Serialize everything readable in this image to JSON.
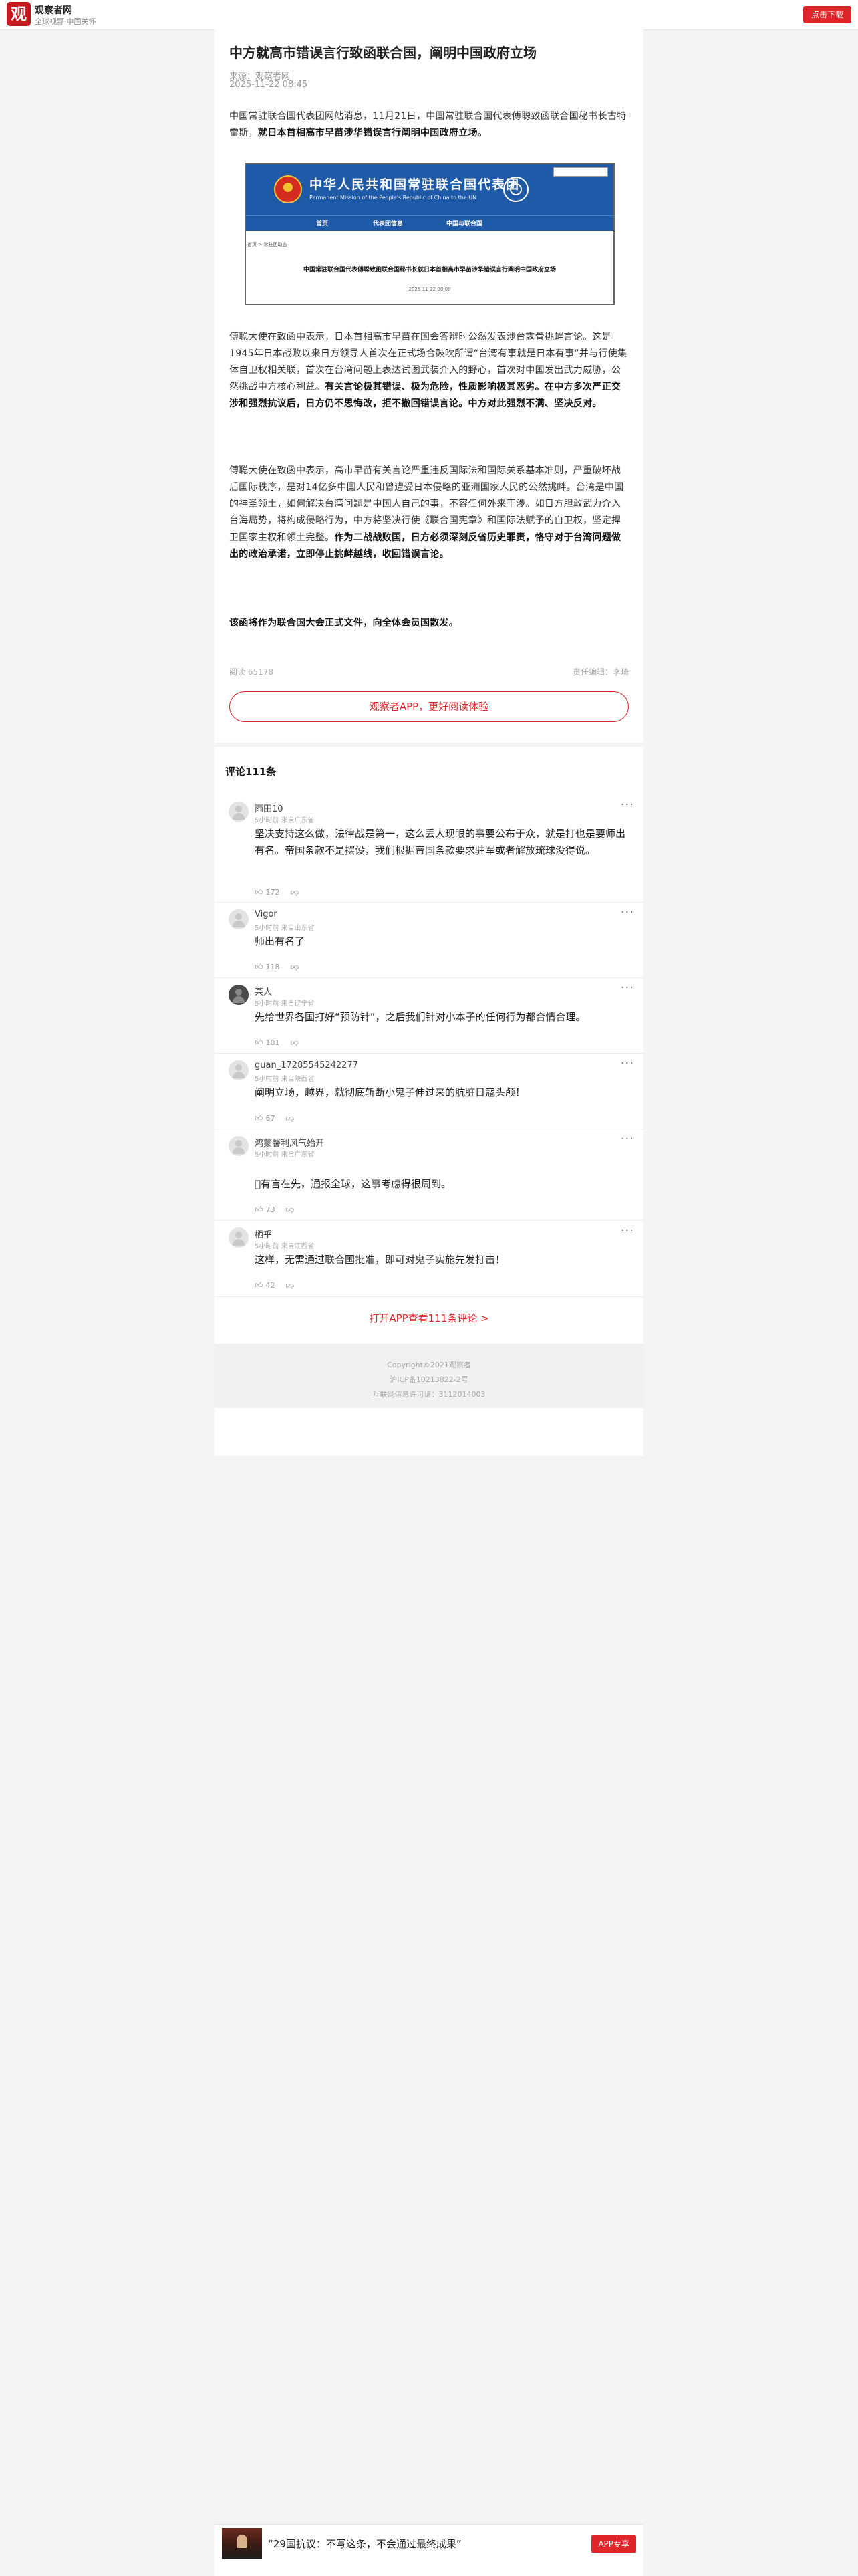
{
  "header": {
    "logo_glyph": "观",
    "site_name": "观察者网",
    "slogan": "全球视野·中国关怀",
    "download_label": "点击下载"
  },
  "article": {
    "title": "中方就高市错误言行致函联合国，阐明中国政府立场",
    "source": "来源：观察者网",
    "date": "2025-11-22 08:45",
    "p1_normal": "中国常驻联合国代表团网站消息，11月21日，中国常驻联合国代表傅聪致函联合国秘书长古特雷斯，",
    "p1_bold": "就日本首相高市早苗涉华错误言行阐明中国政府立场。",
    "p2_normal": "傅聪大使在致函中表示，日本首相高市早苗在国会答辩时公然发表涉台露骨挑衅言论。这是1945年日本战败以来日方领导人首次在正式场合鼓吹所谓“台湾有事就是日本有事”并与行使集体自卫权相关联，首次在台湾问题上表达试图武装介入的野心，首次对中国发出武力威胁，公然挑战中方核心利益。",
    "p2_bold": "有关言论极其错误、极为危险，性质影响极其恶劣。在中方多次严正交涉和强烈抗议后，日方仍不思悔改，拒不撤回错误言论。中方对此强烈不满、坚决反对。",
    "p3_normal": "傅聪大使在致函中表示，高市早苗有关言论严重违反国际法和国际关系基本准则，严重破坏战后国际秩序，是对14亿多中国人民和曾遭受日本侵略的亚洲国家人民的公然挑衅。台湾是中国的神圣领土，如何解决台湾问题是中国人自己的事，不容任何外来干涉。如日方胆敢武力介入台海局势，将构成侵略行为，中方将坚决行使《联合国宪章》和国际法赋予的自卫权，坚定捍卫国家主权和领土完整。",
    "p3_bold": "作为二战战败国，日方必须深刻反省历史罪责，恪守对于台湾问题做出的政治承诺，立即停止挑衅越线，收回错误言论。",
    "p4_bold": "该函将作为联合国大会正式文件，向全体会员国散发。",
    "read_count": "阅读 65178",
    "editor": "责任编辑：李琦",
    "app_button_label": "观察者APP，更好阅读体验"
  },
  "embedded_image": {
    "org_cn": "中华人民共和国常驻联合国代表团",
    "org_en": "Permanent Mission of the People's Republic of China to the UN",
    "nav": [
      "首页",
      "代表团信息",
      "中国与联合国"
    ],
    "breadcrumb": "首页 > 常驻团动态",
    "headline": "中国常驻联合国代表傅聪致函联合国秘书长就日本首相高市早苗涉华错误言行阐明中国政府立场",
    "date": "2025-11-22 00:00"
  },
  "comments": {
    "header": "评论111条",
    "items": [
      {
        "name": "雨田10",
        "meta": "5小时前  来自广东省",
        "text": "坚决支持这么做，法律战是第一，这么丢人现眼的事要公布于众，就是打也是要师出有名。帝国条款不是摆设，我们根据帝国条款要求驻军或者解放琉球没得说。",
        "likes": "172"
      },
      {
        "name": "Vigor",
        "meta": "5小时前  来自山东省",
        "text": "师出有名了",
        "likes": "118"
      },
      {
        "name": "某人",
        "meta": "5小时前  来自辽宁省",
        "text": "先给世界各国打好“预防针”，之后我们针对小本子的任何行为都合情合理。",
        "likes": "101"
      },
      {
        "name": "guan_17285545242277",
        "meta": "5小时前  来自陕西省",
        "text": "阐明立场，越界，就彻底斩断小鬼子伸过来的肮脏日寇头颅！",
        "likes": "67"
      },
      {
        "name": "鸿蒙馨利风气始开",
        "meta": "5小时前  来自广东省",
        "text": "􏰀有言在先，通报全球，这事考虑得很周到。",
        "likes": "73"
      },
      {
        "name": "栖乎",
        "meta": "5小时前  来自江西省",
        "text": "这样，无需通过联合国批准，即可对鬼子实施先发打击！",
        "likes": "42"
      }
    ],
    "open_app_link": "打开APP查看111条评论 >"
  },
  "footer": {
    "copyright": "Copyright©2021观察者",
    "icp": "沪ICP备10213822-2号",
    "license": "互联网信息许可证：3112014003"
  },
  "bottom_banner": {
    "text": "“29国抗议：不写这条，不会通过最终成果”",
    "button_label": "APP专享"
  }
}
